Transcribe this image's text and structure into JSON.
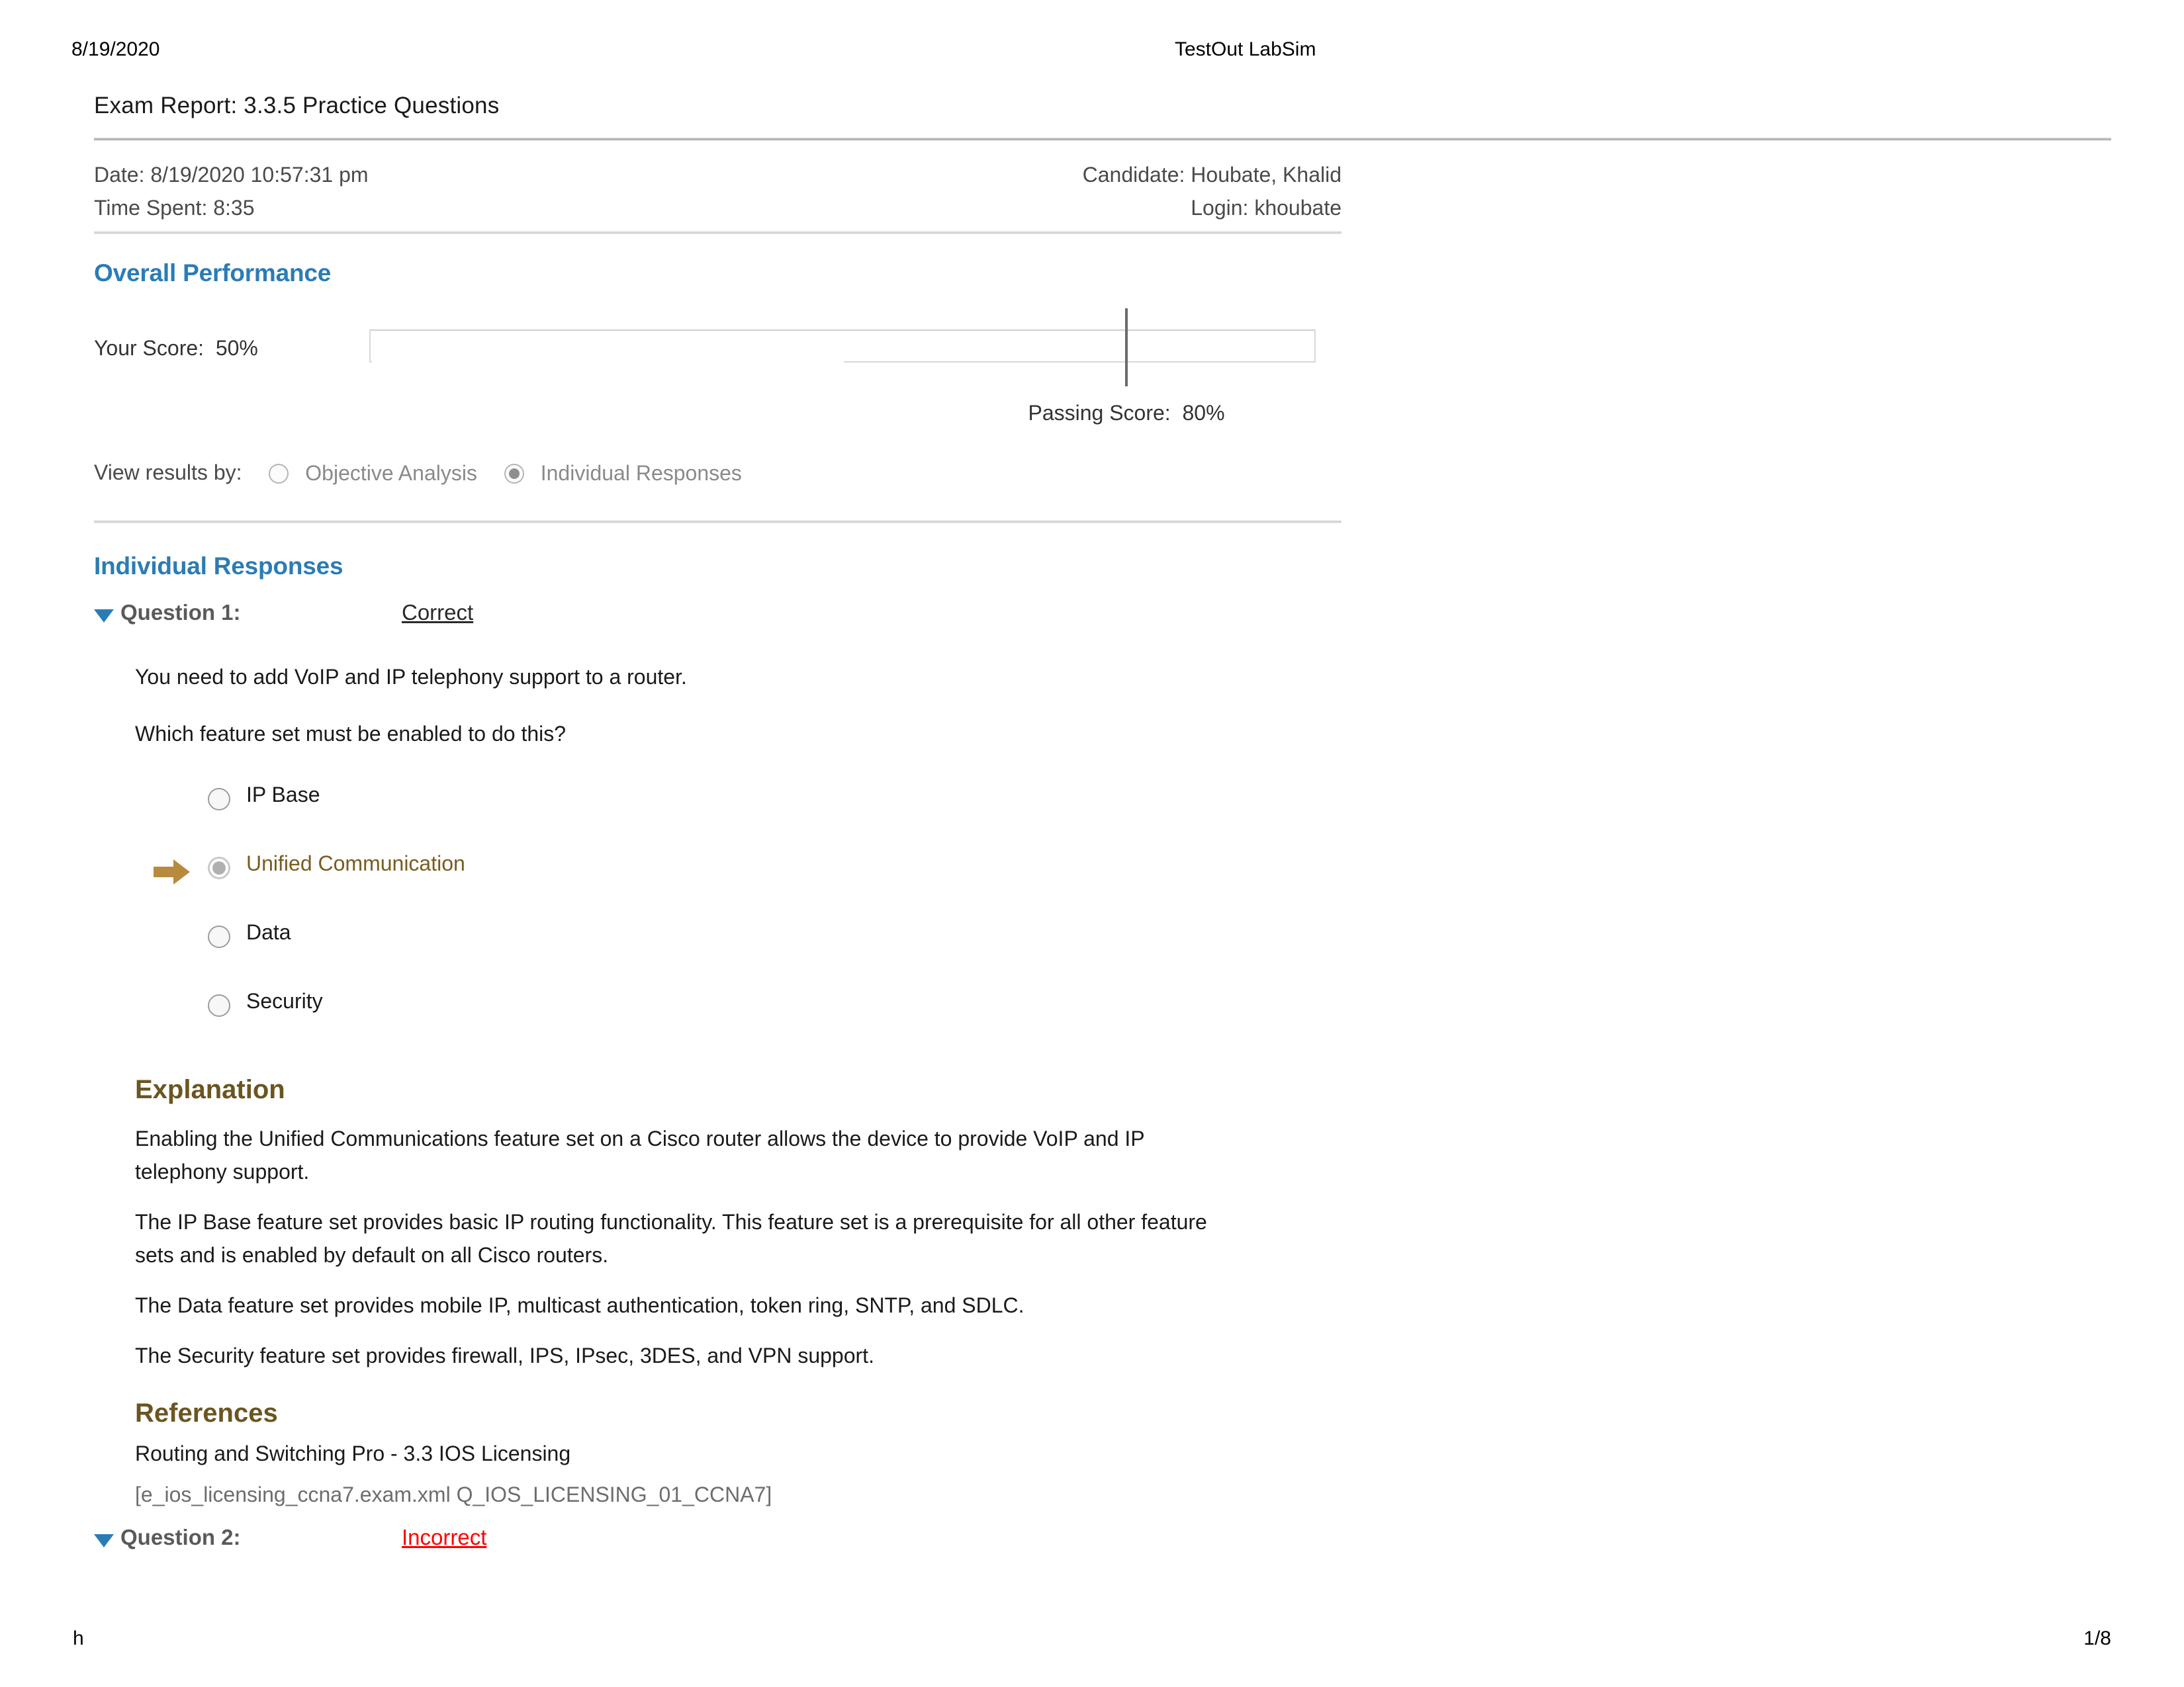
{
  "print_header": {
    "date": "8/19/2020",
    "site": "TestOut LabSim"
  },
  "print_footer": {
    "left": "h",
    "page": "1/8"
  },
  "report": {
    "title": "Exam Report: 3.3.5 Practice Questions",
    "meta": {
      "date_label": "Date: 8/19/2020 10:57:31 pm",
      "candidate_label": "Candidate: Houbate, Khalid",
      "time_spent_label": "Time Spent: 8:35",
      "login_label": "Login: khoubate"
    },
    "overall_performance": {
      "heading": "Overall Performance",
      "your_score_label": "Your Score:  50%",
      "your_score_value": 50,
      "passing_score_label": "Passing Score:  80%",
      "passing_score_value": 80
    },
    "view_results": {
      "label": "View results by:",
      "options": [
        {
          "label": "Objective Analysis",
          "selected": false
        },
        {
          "label": "Individual Responses",
          "selected": true
        }
      ]
    },
    "individual_responses": {
      "heading": "Individual Responses",
      "questions": [
        {
          "label": "Question 1:",
          "status": "Correct",
          "status_kind": "correct",
          "stem_lines": [
            "You need to add VoIP and IP telephony support to a router.",
            "Which feature set must be enabled to do this?"
          ],
          "answers": [
            {
              "text": "IP Base",
              "selected": false,
              "arrow": false
            },
            {
              "text": "Unified Communication",
              "selected": true,
              "arrow": true
            },
            {
              "text": "Data",
              "selected": false,
              "arrow": false
            },
            {
              "text": "Security",
              "selected": false,
              "arrow": false
            }
          ],
          "explanation_heading": "Explanation",
          "explanation_paragraphs": [
            "Enabling the Unified Communications feature set on a Cisco router allows the device to provide VoIP and IP telephony support.",
            "The IP Base feature set provides basic IP routing functionality. This feature set is a prerequisite for all other feature sets and is enabled by default on all Cisco routers.",
            "The Data feature set provides mobile IP, multicast authentication, token ring, SNTP, and SDLC.",
            "The Security feature set provides firewall, IPS, IPsec, 3DES, and VPN support."
          ],
          "references_heading": "References",
          "references": [
            "Routing and Switching Pro - 3.3 IOS Licensing",
            "[e_ios_licensing_ccna7.exam.xml Q_IOS_LICENSING_01_CCNA7]"
          ]
        },
        {
          "label": "Question 2:",
          "status": "Incorrect",
          "status_kind": "incorrect"
        }
      ]
    }
  },
  "colors": {
    "accent_blue": "#2b7cb5",
    "brown": "#6b5520",
    "selected_text": "#7a5c1e",
    "arrow_gold": "#b88a3d",
    "incorrect_red": "#ff0000"
  }
}
